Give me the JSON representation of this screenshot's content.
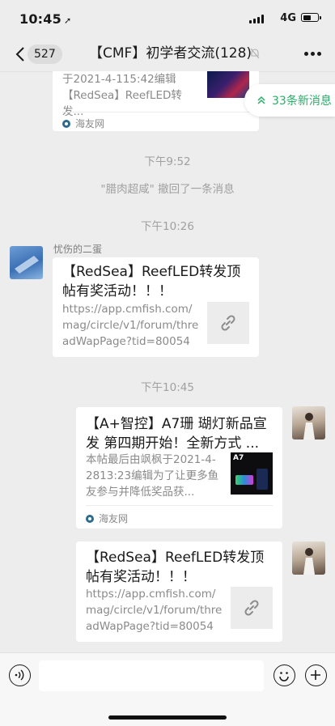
{
  "status": {
    "time": "10:45",
    "network": "4G",
    "battery_level": 0.55
  },
  "nav": {
    "unread_count": "527",
    "title": "【CMF】初学者交流(128)"
  },
  "new_messages": {
    "label": "33条新消息"
  },
  "messages": [
    {
      "type": "card",
      "desc": "于2021-4-115:42编辑【RedSea】ReefLED转发...",
      "source": "海友网"
    },
    {
      "type": "timestamp",
      "text": "下午9:52"
    },
    {
      "type": "recall",
      "text": "\"腊肉超咸\" 撤回了一条消息"
    },
    {
      "type": "timestamp",
      "text": "下午10:26"
    },
    {
      "type": "link",
      "sender": "忧伤的二蛋",
      "title": "【RedSea】ReefLED转发顶帖有奖活动！！！",
      "url": "https://app.cmfish.com/mag/circle/v1/forum/threadWapPage?tid=800547..."
    },
    {
      "type": "timestamp",
      "text": "下午10:45"
    },
    {
      "type": "card",
      "title": "【A+智控】A7珊 瑚灯新品宣发 第四期开始！全新方式 ...",
      "desc": "本帖最后由飒枫于2021-4-2813:23编辑为了让更多鱼友参与并降低奖品获...",
      "source": "海友网"
    },
    {
      "type": "link",
      "title": "【RedSea】ReefLED转发顶帖有奖活动！！！",
      "url": "https://app.cmfish.com/mag/circle/v1/forum/threadWapPage?tid=800547..."
    }
  ],
  "icons": {
    "back": "chevron-left-icon",
    "mute": "bell-off-icon",
    "more": "ellipsis-icon",
    "link": "link-icon",
    "voice": "voice-icon",
    "emoji": "emoji-icon",
    "plus": "plus-icon",
    "new_msg": "double-chevron-up-icon"
  },
  "colors": {
    "accent": "#2aae67",
    "background": "#ededed"
  }
}
